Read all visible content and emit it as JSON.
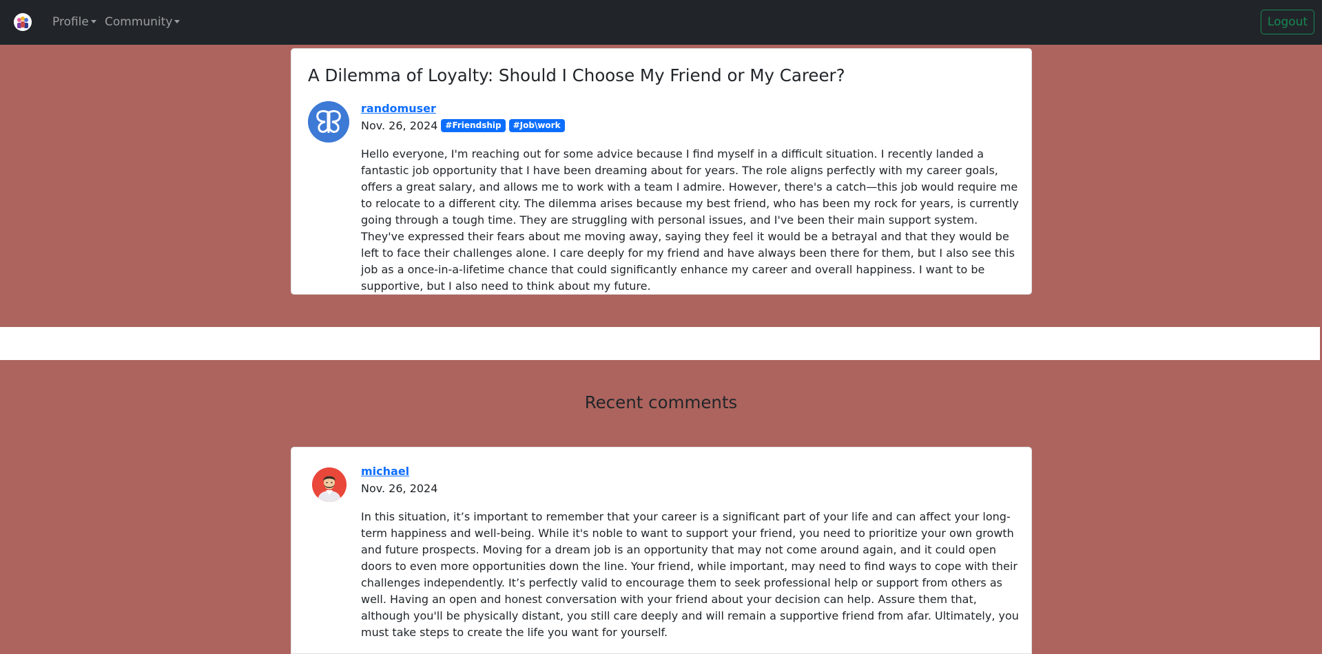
{
  "navbar": {
    "logo_icon": "community-logo-icon",
    "profile_label": "Profile",
    "community_label": "Community",
    "logout_label": "Logout"
  },
  "post": {
    "title": "A Dilemma of Loyalty: Should I Choose My Friend or My Career?",
    "author": "randomuser",
    "avatar_icon": "butterfly-avatar-icon",
    "date": "Nov. 26, 2024",
    "tags": [
      "#Friendship",
      "#Job\\work"
    ],
    "body": "Hello everyone, I'm reaching out for some advice because I find myself in a difficult situation. I recently landed a fantastic job opportunity that I have been dreaming about for years. The role aligns perfectly with my career goals, offers a great salary, and allows me to work with a team I admire. However, there's a catch—this job would require me to relocate to a different city. The dilemma arises because my best friend, who has been my rock for years, is currently going through a tough time. They are struggling with personal issues, and I've been their main support system. They've expressed their fears about me moving away, saying they feel it would be a betrayal and that they would be left to face their challenges alone. I care deeply for my friend and have always been there for them, but I also see this job as a once-in-a-lifetime chance that could significantly enhance my career and overall happiness. I want to be supportive, but I also need to think about my future."
  },
  "comments_section": {
    "heading": "Recent comments",
    "comments": [
      {
        "author": "michael",
        "avatar_icon": "man-avatar-icon",
        "date": "Nov. 26, 2024",
        "body": "In this situation, it’s important to remember that your career is a significant part of your life and can affect your long-term happiness and well-being. While it's noble to want to support your friend, you need to prioritize your own growth and future prospects. Moving for a dream job is an opportunity that may not come around again, and it could open doors to even more opportunities down the line. Your friend, while important, may need to find ways to cope with their challenges independently. It’s perfectly valid to encourage them to seek professional help or support from others as well. Having an open and honest conversation with your friend about your decision can help. Assure them that, although you'll be physically distant, you still care deeply and will remain a supportive friend from afar. Ultimately, you must take steps to create the life you want for yourself."
      }
    ]
  },
  "colors": {
    "page_background": "#ad645e",
    "navbar": "#212529",
    "link": "#0d6efd",
    "tag": "#0d6efd",
    "logout": "#198754"
  }
}
